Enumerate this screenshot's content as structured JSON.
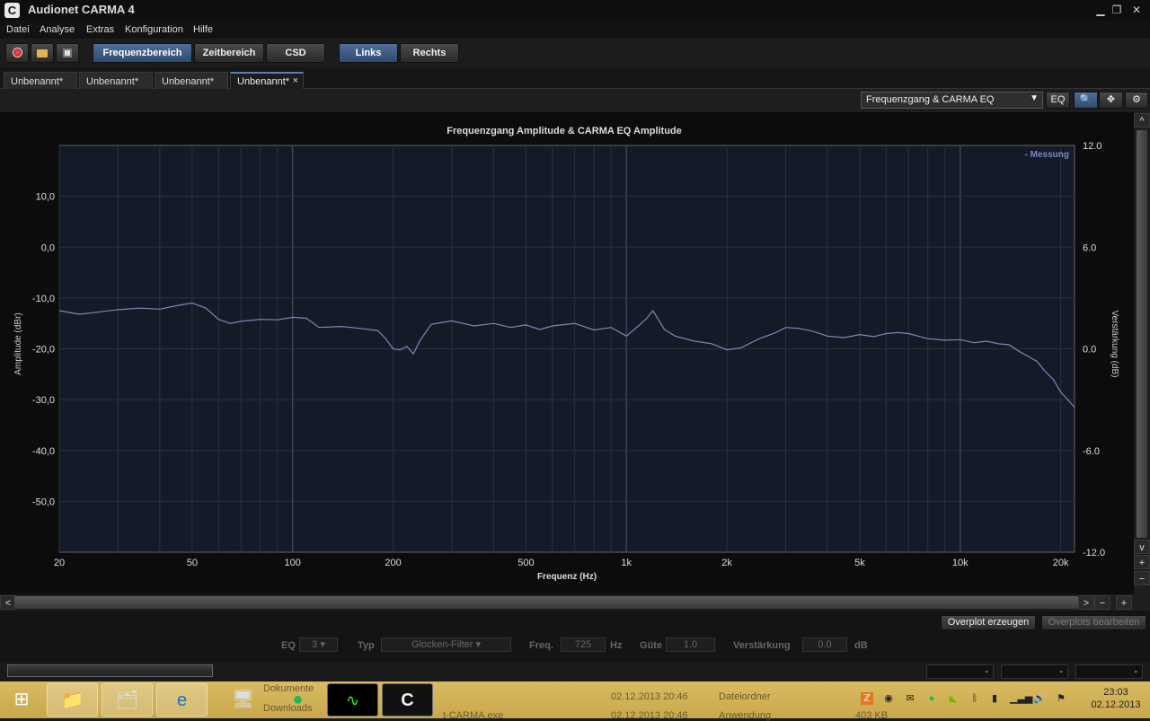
{
  "window": {
    "title": "Audionet CARMA 4",
    "app_icon": "C",
    "minimize": "▁",
    "restore": "❐",
    "close": "✕"
  },
  "menu": [
    "Datei",
    "Analyse",
    "Extras",
    "Konfiguration",
    "Hilfe"
  ],
  "toolbar": {
    "views": [
      "Frequenzbereich",
      "Zeitbereich",
      "CSD"
    ],
    "channels": [
      "Links",
      "Rechts"
    ],
    "icons": [
      "record-icon",
      "open-folder-icon",
      "save-icon"
    ]
  },
  "tabs": [
    {
      "label": "Unbenannt*"
    },
    {
      "label": "Unbenannt*"
    },
    {
      "label": "Unbenannt*"
    },
    {
      "label": "Unbenannt*",
      "close": "×"
    }
  ],
  "viewbar": {
    "select_value": "Frequenzgang & CARMA EQ",
    "eq_button": "EQ"
  },
  "chart_data": {
    "type": "line",
    "title": "Frequenzgang Amplitude & CARMA EQ Amplitude",
    "xlabel": "Frequenz (Hz)",
    "ylabel": "Amplitude (dBr)",
    "y2label": "Verstärkung (dB)",
    "x_scale": "log",
    "xlim": [
      20,
      22000
    ],
    "ylim": [
      -60,
      20
    ],
    "y2lim": [
      -12,
      12
    ],
    "x_ticks": [
      {
        "v": 20,
        "l": "20"
      },
      {
        "v": 50,
        "l": "50"
      },
      {
        "v": 100,
        "l": "100"
      },
      {
        "v": 200,
        "l": "200"
      },
      {
        "v": 500,
        "l": "500"
      },
      {
        "v": 1000,
        "l": "1k"
      },
      {
        "v": 2000,
        "l": "2k"
      },
      {
        "v": 5000,
        "l": "5k"
      },
      {
        "v": 10000,
        "l": "10k"
      },
      {
        "v": 20000,
        "l": "20k"
      }
    ],
    "y_ticks": [
      {
        "v": 10,
        "l": "10,0"
      },
      {
        "v": 0,
        "l": "0,0"
      },
      {
        "v": -10,
        "l": "-10,0"
      },
      {
        "v": -20,
        "l": "-20,0"
      },
      {
        "v": -30,
        "l": "-30,0"
      },
      {
        "v": -40,
        "l": "-40,0"
      },
      {
        "v": -50,
        "l": "-50,0"
      }
    ],
    "y2_ticks": [
      {
        "v": 12,
        "l": "12.0"
      },
      {
        "v": 6,
        "l": "6.0"
      },
      {
        "v": 0,
        "l": "0.0"
      },
      {
        "v": -6,
        "l": "-6.0"
      },
      {
        "v": -12,
        "l": "-12.0"
      }
    ],
    "legend": "- Messung",
    "legend_position": "top-right",
    "grid": true,
    "series": [
      {
        "name": "Messung",
        "color": "#8088b8",
        "x": [
          20,
          23,
          26,
          30,
          35,
          40,
          45,
          50,
          55,
          60,
          65,
          70,
          80,
          90,
          100,
          110,
          120,
          140,
          160,
          180,
          190,
          200,
          210,
          220,
          230,
          240,
          260,
          280,
          300,
          350,
          400,
          450,
          500,
          550,
          600,
          700,
          800,
          900,
          1000,
          1100,
          1150,
          1200,
          1300,
          1400,
          1600,
          1800,
          2000,
          2200,
          2500,
          2800,
          3000,
          3300,
          3600,
          4000,
          4500,
          5000,
          5500,
          6000,
          6500,
          7000,
          8000,
          9000,
          10000,
          11000,
          12000,
          13000,
          14000,
          15000,
          16000,
          17000,
          18000,
          19000,
          20000,
          21000,
          22000
        ],
        "y": [
          -12.5,
          -13.2,
          -12.8,
          -12.3,
          -12.0,
          -12.2,
          -11.5,
          -11.0,
          -12.0,
          -14.2,
          -15.0,
          -14.6,
          -14.2,
          -14.3,
          -13.8,
          -14.0,
          -15.8,
          -15.6,
          -16.0,
          -16.4,
          -18.0,
          -20.0,
          -20.2,
          -19.5,
          -21.0,
          -18.5,
          -15.2,
          -14.8,
          -14.5,
          -15.5,
          -15.0,
          -15.8,
          -15.3,
          -16.2,
          -15.5,
          -15.0,
          -16.3,
          -15.8,
          -17.5,
          -15.2,
          -14.0,
          -12.5,
          -16.2,
          -17.5,
          -18.5,
          -19.0,
          -20.2,
          -19.8,
          -18.0,
          -16.8,
          -15.8,
          -16.0,
          -16.5,
          -17.5,
          -17.8,
          -17.2,
          -17.6,
          -17.0,
          -16.8,
          -17.0,
          -18.0,
          -18.3,
          -18.2,
          -18.8,
          -18.5,
          -19.0,
          -19.2,
          -20.5,
          -21.5,
          -22.5,
          -24.5,
          -26.0,
          -28.5,
          -30.0,
          -31.5
        ]
      }
    ]
  },
  "hscroll": {
    "left": "<",
    "right": ">",
    "minus": "−",
    "plus": "+"
  },
  "vscroll": {
    "up": "^",
    "down": "v",
    "plus": "+",
    "minus": "−"
  },
  "overplot": {
    "create": "Overplot erzeugen",
    "edit": "Overplots bearbeiten"
  },
  "eq": {
    "eq_label": "EQ",
    "eq_value": "3",
    "typ_label": "Typ",
    "typ_value": "Glocken-Filter",
    "freq_label": "Freq.",
    "freq_value": "725",
    "freq_unit": "Hz",
    "gute_label": "Güte",
    "gute_value": "1.0",
    "gain_label": "Verstärkung",
    "gain_value": "0.0",
    "gain_unit": "dB"
  },
  "status": {
    "fields": [
      "-",
      "-",
      "-"
    ]
  },
  "taskbar": {
    "time": "23:03",
    "date": "02.12.2013",
    "ghost": [
      "Dokumente",
      "Downloads",
      "02.12.2013 20:46",
      "Dateiordner",
      "02.12.2013 20:46",
      "Anwendung",
      "403 KB",
      "t-CARMA.exe"
    ]
  }
}
